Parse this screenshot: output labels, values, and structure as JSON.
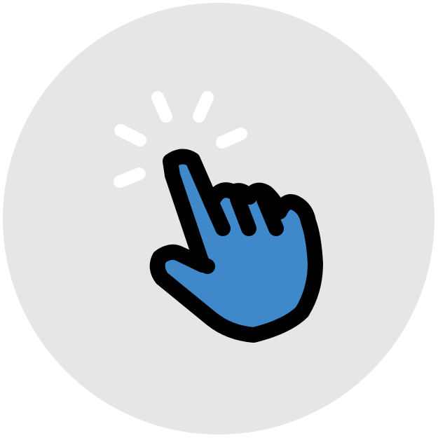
{
  "icon": {
    "name": "click-hand-icon",
    "colors": {
      "background": "#ffffff",
      "circle": "#e6e6e6",
      "hand_fill": "#3f88c9",
      "outline": "#000000",
      "rays": "#ffffff"
    }
  }
}
